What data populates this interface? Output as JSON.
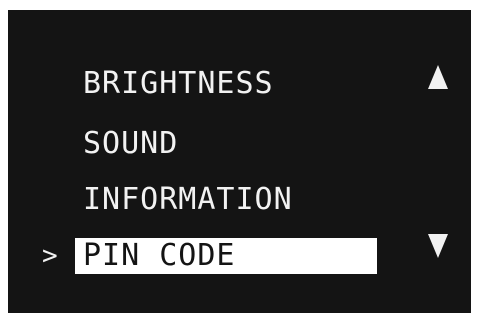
{
  "menu": {
    "cursor": ">",
    "items": [
      {
        "label": "BRIGHTNESS"
      },
      {
        "label": "SOUND"
      },
      {
        "label": "INFORMATION"
      },
      {
        "label": "PIN CODE",
        "selected": true
      }
    ]
  },
  "icons": {
    "scroll_up": "triangle-up-icon",
    "scroll_down": "triangle-down-icon"
  },
  "colors": {
    "screen_background": "#141414",
    "text": "#f2f2f2",
    "highlight": "#ffffff"
  }
}
